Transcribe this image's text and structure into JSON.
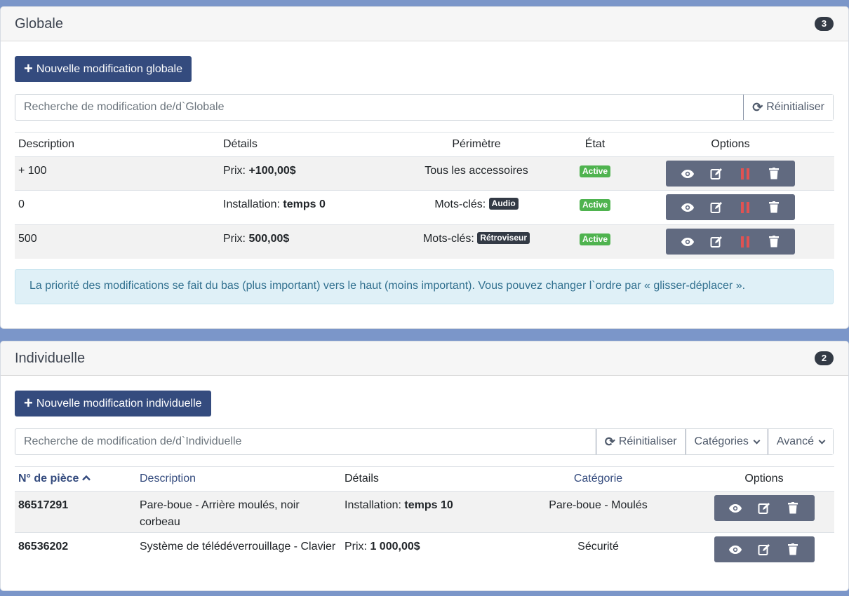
{
  "globale": {
    "title": "Globale",
    "count": "3",
    "new_button": "Nouvelle modification globale",
    "search_placeholder": "Recherche de modification de/d`Globale",
    "reset_label": "Réinitialiser",
    "columns": [
      "Description",
      "Détails",
      "Périmètre",
      "État",
      "Options"
    ],
    "rows": [
      {
        "description": "+ 100",
        "detail_label": "Prix:",
        "detail_value": "+100,00$",
        "scope_text": "Tous les accessoires",
        "scope_tag": "",
        "status": "Active"
      },
      {
        "description": "0",
        "detail_label": "Installation:",
        "detail_value": "temps 0",
        "scope_text": "Mots-clés:",
        "scope_tag": "Audio",
        "status": "Active"
      },
      {
        "description": "500",
        "detail_label": "Prix:",
        "detail_value": "500,00$",
        "scope_text": "Mots-clés:",
        "scope_tag": "Rétroviseur",
        "status": "Active"
      }
    ],
    "notice": "La priorité des modifications se fait du bas (plus important) vers le haut (moins important). Vous pouvez changer l`ordre par « glisser-déplacer »."
  },
  "individuelle": {
    "title": "Individuelle",
    "count": "2",
    "new_button": "Nouvelle modification individuelle",
    "search_placeholder": "Recherche de modification de/d`Individuelle",
    "reset_label": "Réinitialiser",
    "categories_label": "Catégories",
    "advanced_label": "Avancé",
    "columns": [
      "N° de pièce",
      "Description",
      "Détails",
      "Catégorie",
      "Options"
    ],
    "rows": [
      {
        "part": "86517291",
        "description": "Pare-boue - Arrière moulés, noir corbeau",
        "detail_label": "Installation:",
        "detail_value": "temps 10",
        "category": "Pare-boue - Moulés"
      },
      {
        "part": "86536202",
        "description": "Système de télédéverrouillage - Clavier",
        "detail_label": "Prix:",
        "detail_value": "1 000,00$",
        "category": "Sécurité"
      }
    ]
  },
  "colors": {
    "primary": "#344b7e",
    "active": "#4fb34f",
    "pause": "#e05252",
    "options_bg": "#616a80"
  }
}
